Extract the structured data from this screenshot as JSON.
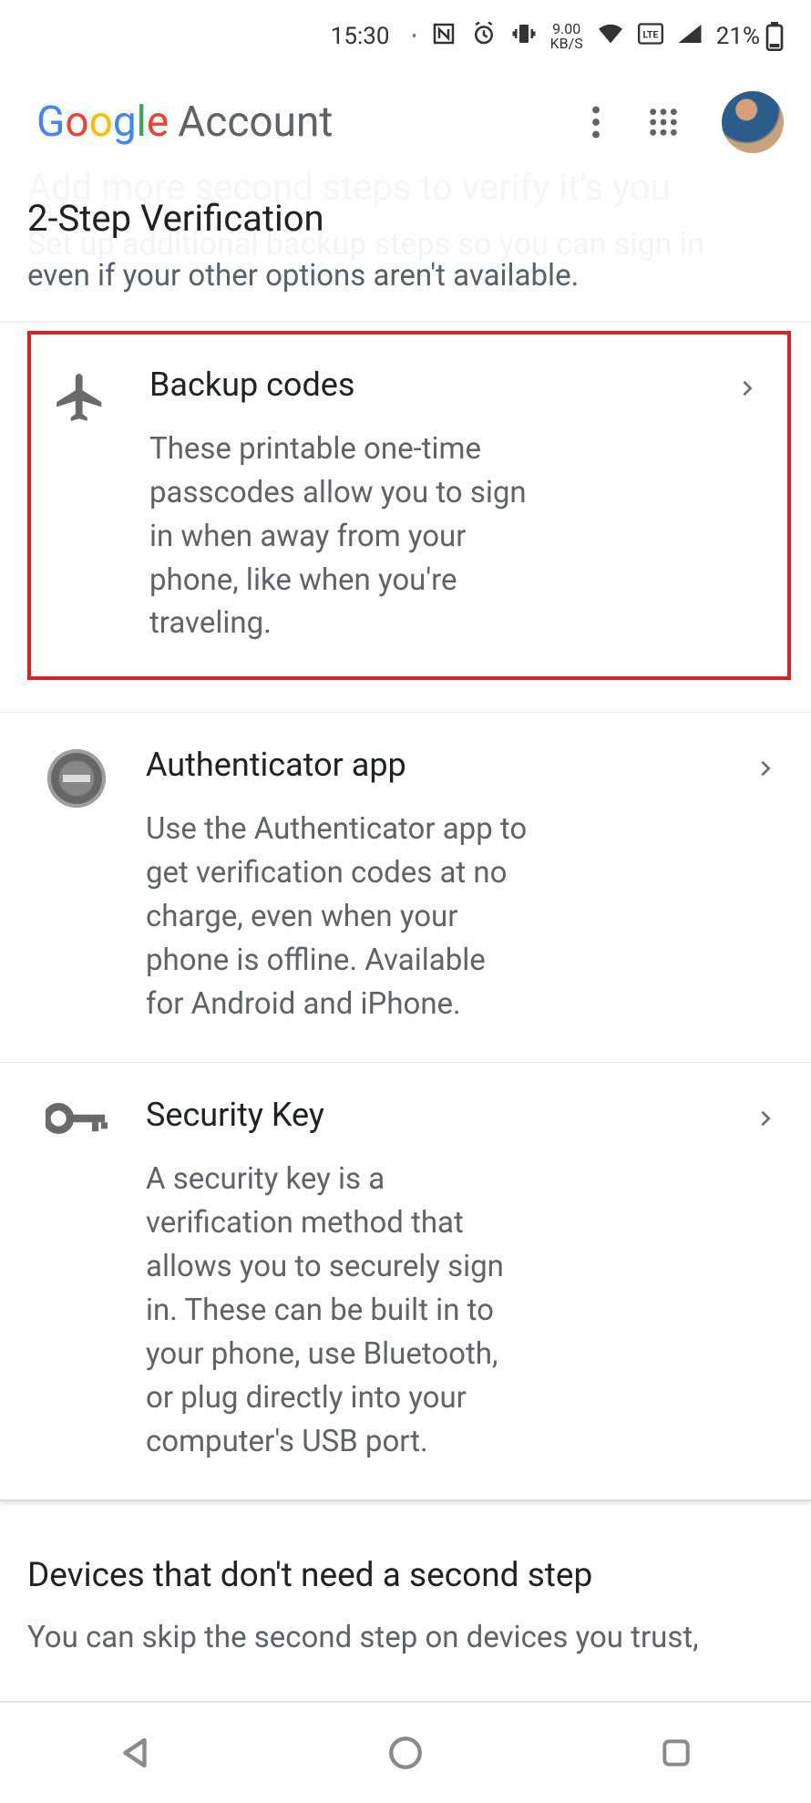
{
  "status": {
    "time": "15:30",
    "kbps_top": "9.00",
    "kbps_bottom": "KB/S",
    "battery": "21%"
  },
  "header": {
    "logo": "Google",
    "account_word": "Account"
  },
  "page": {
    "ghost_title": "Add more second steps to verify it's you",
    "title": "2-Step Verification",
    "ghost_sub": "Set up additional backup steps so you can sign in",
    "subline": "even if your other options aren't available."
  },
  "options": [
    {
      "icon": "airplane",
      "title": "Backup codes",
      "desc": "These printable one-time passcodes allow you to sign in when away from your phone, like when you're traveling."
    },
    {
      "icon": "authenticator",
      "title": "Authenticator app",
      "desc": "Use the Authenticator app to get verification codes at no charge, even when your phone is offline. Available for Android and iPhone."
    },
    {
      "icon": "key",
      "title": "Security Key",
      "desc": "A security key is a verification method that allows you to securely sign in. These can be built in to your phone, use Bluetooth, or plug directly into your computer's USB port."
    }
  ],
  "section": {
    "title": "Devices that don't need a second step",
    "desc": "You can skip the second step on devices you trust,"
  }
}
